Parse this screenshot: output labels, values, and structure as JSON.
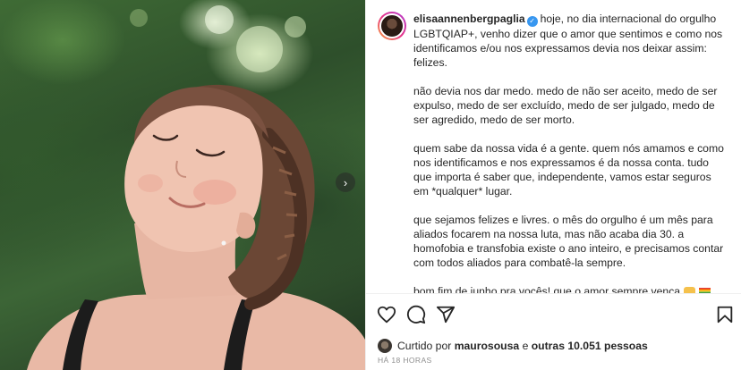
{
  "post": {
    "username": "elisaannenbergpaglia",
    "verified_icon": "verified-badge-icon",
    "caption_first": "hoje, no dia internacional do orgulho LGBTQIAP+, venho dizer que o amor que sentimos e como nos identificamos e/ou nos expressamos devia nos deixar assim: felizes.",
    "paragraphs": [
      "não devia nos dar medo. medo de não ser aceito, medo de ser expulso, medo de ser excluído, medo de ser julgado, medo de ser agredido, medo de ser morto.",
      "quem sabe da nossa vida é a gente. quem nós amamos e como nos identificamos e nos expressamos é da nossa conta. tudo que importa é saber que, independente, vamos estar seguros em *qualquer* lugar.",
      "que sejamos felizes e livres. o mês do orgulho é um mês para aliados focarem na nossa luta, mas não acaba dia 30. a homofobia e transfobia existe o ano inteiro, e precisamos contar com todos aliados para combatê-la sempre."
    ],
    "closing": "bom fim de junho pra vocês! que o amor sempre vença",
    "closing_emojis": [
      "handshake-emoji",
      "rainbow-flag-emoji"
    ]
  },
  "actions": {
    "icons": [
      "heart-icon",
      "comment-icon",
      "share-icon",
      "bookmark-icon"
    ]
  },
  "likes": {
    "prefix": "Curtido por",
    "first_user": "maurosousa",
    "joiner": "e",
    "others": "outras 10.051 pessoas"
  },
  "timestamp": "HÁ 18 HORAS",
  "carousel": {
    "next_icon": "chevron-right-icon",
    "next_glyph": "›"
  },
  "colors": {
    "text": "#262626",
    "secondary": "#8e8e8e",
    "verified": "#3897f0"
  }
}
